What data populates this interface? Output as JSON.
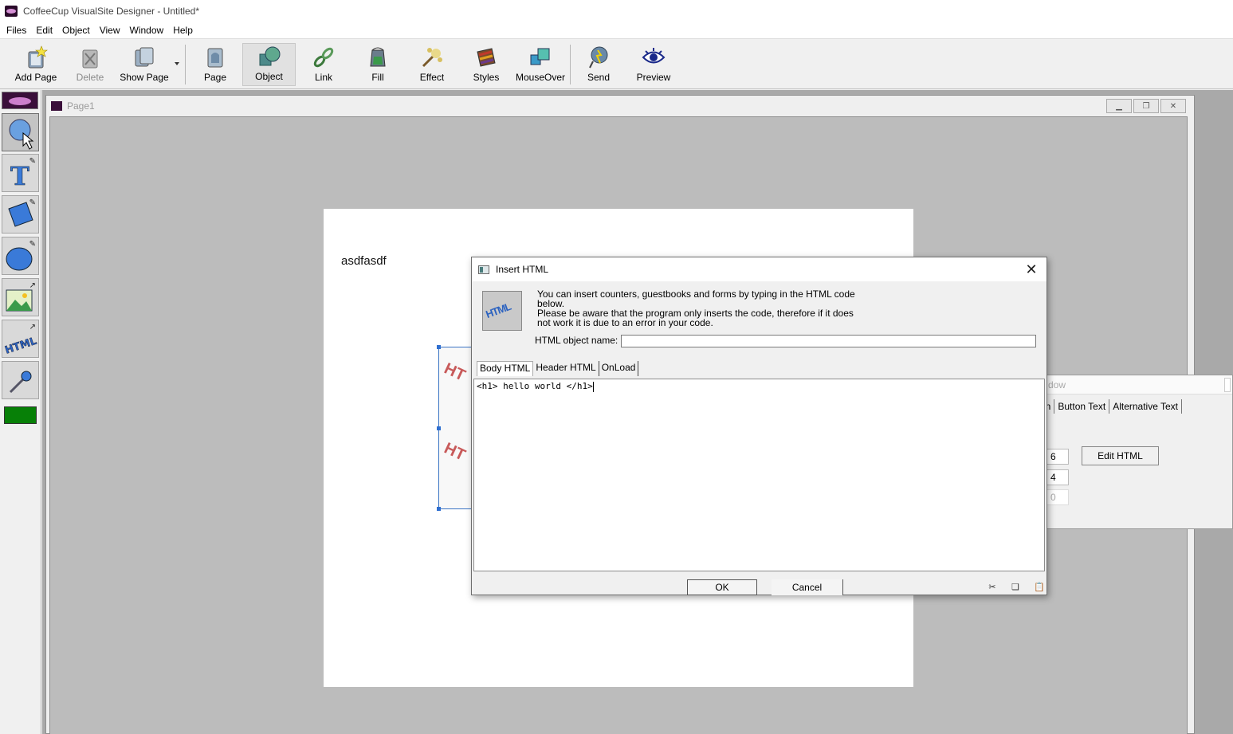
{
  "app": {
    "title": "CoffeeCup VisualSite Designer - Untitled*"
  },
  "menu": {
    "items": [
      {
        "label": "Files"
      },
      {
        "label": "Edit"
      },
      {
        "label": "Object"
      },
      {
        "label": "View"
      },
      {
        "label": "Window"
      },
      {
        "label": "Help"
      }
    ]
  },
  "toolbar": {
    "add_page": "Add Page",
    "delete": "Delete",
    "show_page": "Show Page",
    "page": "Page",
    "object": "Object",
    "link": "Link",
    "fill": "Fill",
    "effect": "Effect",
    "styles": "Styles",
    "mouseover": "MouseOver",
    "send": "Send",
    "preview": "Preview"
  },
  "page_window": {
    "title": "Page1",
    "text_object": "asdfasdf"
  },
  "properties": {
    "title_fragment": "dow",
    "tabs": [
      {
        "label": "on"
      },
      {
        "label": "Button Text"
      },
      {
        "label": "Alternative Text"
      }
    ],
    "field1": "6",
    "field2": "4",
    "field3": "0",
    "edit_html": "Edit HTML"
  },
  "dialog": {
    "title": "Insert HTML",
    "description_line1": "You can insert counters, guestbooks and forms by typing in the HTML code",
    "description_line2": "below.",
    "description_line3": "Please be aware that the program only inserts the code, therefore if it does",
    "description_line4": "not work it is due to an error in your code.",
    "name_label": "HTML object name:",
    "name_value": "",
    "tabs": [
      {
        "label": "Body HTML"
      },
      {
        "label": "Header HTML"
      },
      {
        "label": "OnLoad"
      }
    ],
    "editor_content": "<h1> hello world </h1>",
    "ok": "OK",
    "cancel": "Cancel"
  },
  "colors": {
    "current_color": "#078007",
    "selection": "#2f6fd0"
  }
}
